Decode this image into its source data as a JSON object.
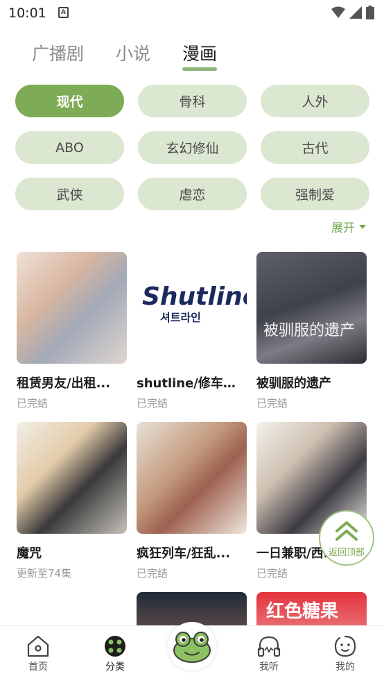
{
  "status_bar": {
    "time": "10:01",
    "notification": "A"
  },
  "tabs": [
    {
      "label": "广播剧",
      "active": false
    },
    {
      "label": "小说",
      "active": false
    },
    {
      "label": "漫画",
      "active": true
    }
  ],
  "categories": [
    {
      "label": "现代",
      "active": true
    },
    {
      "label": "骨科",
      "active": false
    },
    {
      "label": "人外",
      "active": false
    },
    {
      "label": "ABO",
      "active": false
    },
    {
      "label": "玄幻修仙",
      "active": false
    },
    {
      "label": "古代",
      "active": false
    },
    {
      "label": "武侠",
      "active": false
    },
    {
      "label": "虐恋",
      "active": false
    },
    {
      "label": "强制爱",
      "active": false
    }
  ],
  "expand_label": "展开",
  "comics": [
    {
      "title": "租赁男友/出租...",
      "status": "已完结"
    },
    {
      "title": "shutline/修车危...",
      "status": "已完结",
      "cover_text": "Shutline",
      "cover_subtext": "셔트라인"
    },
    {
      "title": "被驯服的遗产",
      "status": "已完结",
      "cover_text": "被驯服的遗产"
    },
    {
      "title": "魔咒",
      "status": "更新至74集"
    },
    {
      "title": "疯狂列车/狂乱...",
      "status": "已完结"
    },
    {
      "title": "一日兼职/西...",
      "status": "已完结"
    },
    {
      "title": "",
      "status": ""
    },
    {
      "title": "",
      "status": ""
    },
    {
      "title": "",
      "status": "",
      "cover_text": "红色糖果"
    }
  ],
  "back_to_top": "返回顶部",
  "bottom_nav": [
    {
      "label": "首页",
      "icon": "home-icon"
    },
    {
      "label": "分类",
      "icon": "category-icon"
    },
    {
      "label": "",
      "icon": "frog-icon"
    },
    {
      "label": "我听",
      "icon": "headphones-icon"
    },
    {
      "label": "我的",
      "icon": "profile-icon"
    }
  ],
  "colors": {
    "accent": "#7eab55",
    "chip_bg": "#dbe7d0",
    "underline": "#8db57a"
  }
}
